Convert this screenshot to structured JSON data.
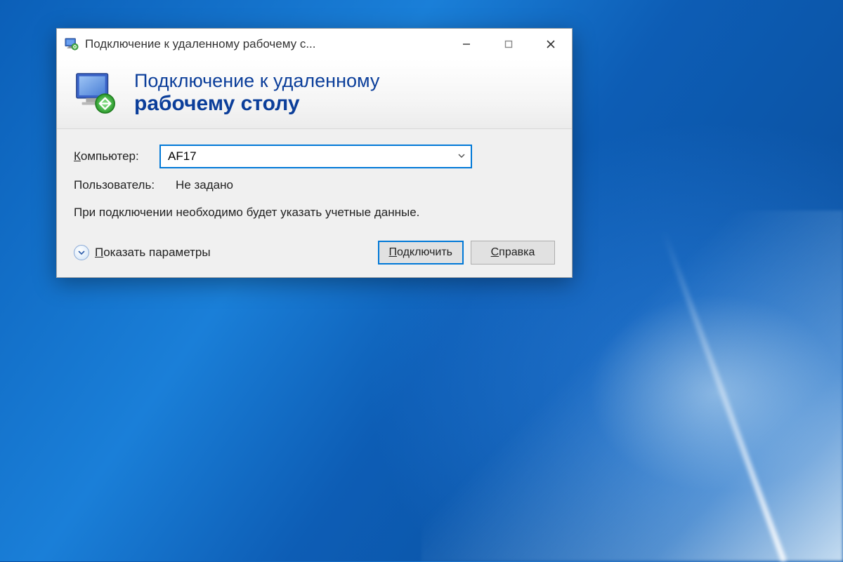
{
  "window": {
    "title": "Подключение к удаленному рабочему с..."
  },
  "banner": {
    "line1": "Подключение к удаленному",
    "line2": "рабочему столу"
  },
  "form": {
    "computer_label": "Компьютер:",
    "computer_value": "AF17",
    "user_label": "Пользователь:",
    "user_value": "Не задано",
    "hint": "При подключении необходимо будет указать учетные данные."
  },
  "footer": {
    "show_options": "Показать параметры",
    "connect": "Подключить",
    "help": "Справка"
  }
}
